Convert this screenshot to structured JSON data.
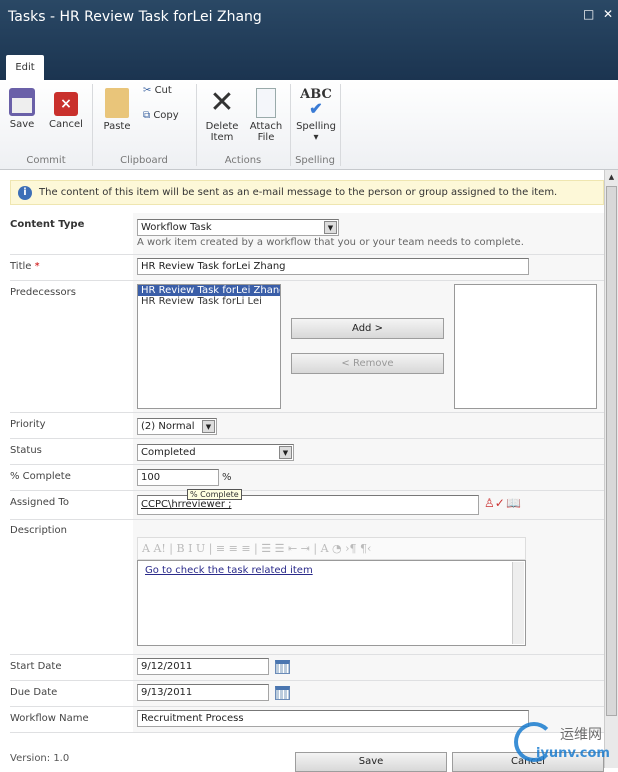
{
  "window": {
    "title": "Tasks - HR Review Task forLei Zhang",
    "maximize": "□",
    "close": "✕"
  },
  "ribbon": {
    "tab": "Edit",
    "buttons": {
      "save": "Save",
      "cancel": "Cancel",
      "paste": "Paste",
      "cut": "Cut",
      "copy": "Copy",
      "delete_1": "Delete",
      "delete_2": "Item",
      "attach_1": "Attach",
      "attach_2": "File",
      "spelling": "Spelling",
      "spelling_arrow": "▾",
      "abc": "ABC"
    },
    "groups": {
      "commit": "Commit",
      "clipboard": "Clipboard",
      "actions": "Actions",
      "spelling": "Spelling"
    }
  },
  "notice": "The content of this item will be sent as an e-mail message to the person or group assigned to the item.",
  "form": {
    "content_type": {
      "label": "Content Type",
      "value": "Workflow Task",
      "help": "A work item created by a workflow that you or your team needs to complete."
    },
    "title": {
      "label": "Title",
      "required": "*",
      "value": "HR Review Task forLei Zhang"
    },
    "predecessors": {
      "label": "Predecessors",
      "options": [
        "HR Review Task forLei Zhang",
        "HR Review Task forLi Lei"
      ],
      "add": "Add >",
      "remove": "< Remove"
    },
    "priority": {
      "label": "Priority",
      "value": "(2) Normal"
    },
    "status": {
      "label": "Status",
      "value": "Completed"
    },
    "percent": {
      "label": "% Complete",
      "value": "100",
      "unit": "%",
      "tooltip": "% Complete"
    },
    "assigned": {
      "label": "Assigned To",
      "value": "CCPC\\hrreviewer ;"
    },
    "description": {
      "label": "Description",
      "toolbar": "A A! | B I U | ≡ ≡ ≡ | ☰ ☰ ⇤ ⇥ | A ◔ ›¶ ¶‹",
      "value": "Go to check the task related item"
    },
    "start_date": {
      "label": "Start Date",
      "value": "9/12/2011"
    },
    "due_date": {
      "label": "Due Date",
      "value": "9/13/2011"
    },
    "workflow": {
      "label": "Workflow Name",
      "value": "Recruitment Process"
    }
  },
  "footer": {
    "version": "Version: 1.0",
    "save": "Save",
    "cancel": "Cancel"
  },
  "watermark": {
    "text1": "运维网",
    "text2": "iyunv.com"
  }
}
